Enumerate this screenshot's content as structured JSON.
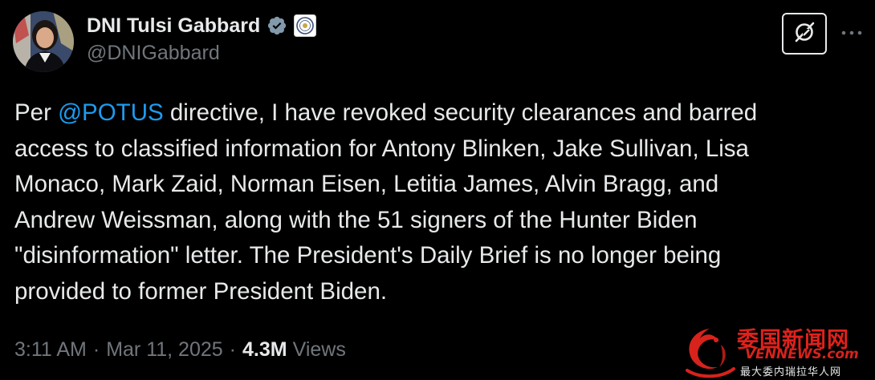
{
  "author": {
    "display_name": "DNI Tulsi Gabbard",
    "handle": "@DNIGabbard",
    "verified_icon": "verified-badge-icon",
    "affiliation_icon": "dni-seal-icon"
  },
  "actions": {
    "grok_icon": "grok-icon",
    "more_label": "···"
  },
  "post": {
    "text_prefix": "Per ",
    "mention": "@POTUS",
    "text_body": " directive, I have revoked security clearances and barred\naccess to classified information for Antony Blinken, Jake Sullivan, Lisa\nMonaco, Mark Zaid, Norman Eisen, Letitia James, Alvin Bragg, and\nAndrew Weissman, along with the 51 signers of the Hunter Biden\n\"disinformation\" letter. The President's Daily Brief is no longer being\nprovided to former President Biden."
  },
  "meta": {
    "time": "3:11 AM",
    "separator": "·",
    "date": "Mar 11, 2025",
    "views_count": "4.3M",
    "views_label": "Views"
  },
  "watermark": {
    "title": "委国新闻网",
    "site": "VENNEWS.com",
    "subtitle": "最大委内瑞拉华人网"
  },
  "colors": {
    "background": "#000000",
    "text": "#e7e9ea",
    "secondary": "#71767b",
    "link": "#1d9bf0",
    "watermark_red": "#e0211c"
  }
}
